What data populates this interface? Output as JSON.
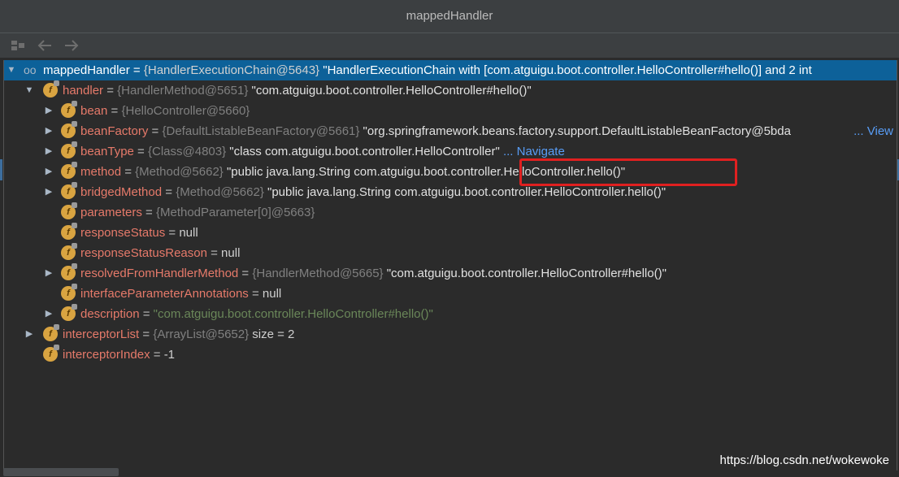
{
  "window": {
    "title": "mappedHandler"
  },
  "toolbar": {
    "icons": [
      "restore-layout-icon",
      "back-arrow-icon",
      "forward-arrow-icon"
    ]
  },
  "tree": {
    "root": {
      "name": "mappedHandler",
      "eq": " = ",
      "ref": "{HandlerExecutionChain@5643}",
      "value": " \"HandlerExecutionChain with [com.atguigu.boot.controller.HelloController#hello()] and 2 int"
    },
    "handler": {
      "name": "handler",
      "eq": " = ",
      "ref": "{HandlerMethod@5651}",
      "value": " \"com.atguigu.boot.controller.HelloController#hello()\""
    },
    "bean": {
      "name": "bean",
      "eq": " = ",
      "ref": "{HelloController@5660}"
    },
    "beanFactory": {
      "name": "beanFactory",
      "eq": " = ",
      "ref": "{DefaultListableBeanFactory@5661}",
      "value": " \"org.springframework.beans.factory.support.DefaultListableBeanFactory@5bda",
      "link": "... View"
    },
    "beanType": {
      "name": "beanType",
      "eq": " = ",
      "ref": "{Class@4803}",
      "value": " \"class com.atguigu.boot.controller.HelloController\"",
      "link": " ... Navigate"
    },
    "method": {
      "name": "method",
      "eq": " = ",
      "ref": "{Method@5662}",
      "value": " \"public java.lang.String com.atguigu.boot.controller.HelloController.hello()\""
    },
    "bridgedMethod": {
      "name": "bridgedMethod",
      "eq": " = ",
      "ref": "{Method@5662}",
      "value": " \"public java.lang.String com.atguigu.boot.controller.HelloController.hello()\""
    },
    "parameters": {
      "name": "parameters",
      "eq": " = ",
      "ref": "{MethodParameter[0]@5663}"
    },
    "responseStatus": {
      "name": "responseStatus",
      "eq": " = ",
      "value": "null"
    },
    "responseStatusReason": {
      "name": "responseStatusReason",
      "eq": " = ",
      "value": "null"
    },
    "resolvedFromHandlerMethod": {
      "name": "resolvedFromHandlerMethod",
      "eq": " = ",
      "ref": "{HandlerMethod@5665}",
      "value": " \"com.atguigu.boot.controller.HelloController#hello()\""
    },
    "interfaceParameterAnnotations": {
      "name": "interfaceParameterAnnotations",
      "eq": " = ",
      "value": "null"
    },
    "description": {
      "name": "description",
      "eq": " = ",
      "value": "\"com.atguigu.boot.controller.HelloController#hello()\""
    },
    "interceptorList": {
      "name": "interceptorList",
      "eq": " = ",
      "ref": "{ArrayList@5652}",
      "value": "  size = 2"
    },
    "interceptorIndex": {
      "name": "interceptorIndex",
      "eq": " = ",
      "value": "-1"
    }
  },
  "watermark": "https://blog.csdn.net/wokewoke",
  "colors": {
    "background": "#2b2b2b",
    "selection": "#0d6199",
    "field_name": "#e67a6a",
    "highlight_box": "#e02020",
    "string_literal": "#6a8759",
    "link": "#589df6"
  }
}
